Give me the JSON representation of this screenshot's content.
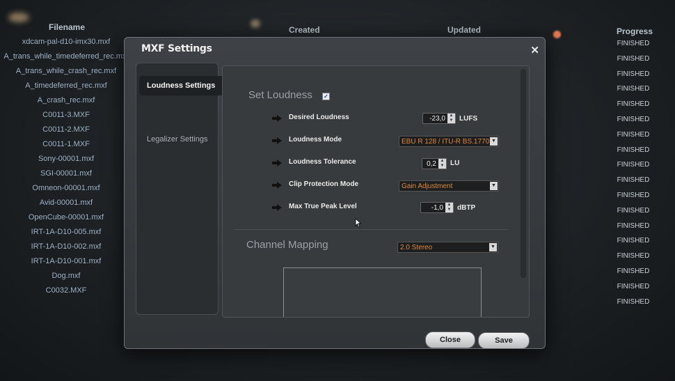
{
  "background": {
    "headers": {
      "filename": "Filename",
      "created": "Created",
      "updated": "Updated",
      "progress": "Progress"
    },
    "files": [
      "xdcam-pal-d10-imx30.mxf",
      "A_trans_while_timedeferred_rec.mxf",
      "A_trans_while_crash_rec.mxf",
      "A_timedeferred_rec.mxf",
      "A_crash_rec.mxf",
      "C0011-3.MXF",
      "C0011-2.MXF",
      "C0011-1.MXF",
      "Sony-00001.mxf",
      "SGI-00001.mxf",
      "Omneon-00001.mxf",
      "Avid-00001.mxf",
      "OpenCube-00001.mxf",
      "IRT-1A-D10-005.mxf",
      "IRT-1A-D10-002.mxf",
      "IRT-1A-D10-001.mxf",
      "Dog.mxf",
      "C0032.MXF"
    ],
    "progress": [
      "FINISHED",
      "FINISHED",
      "FINISHED",
      "FINISHED",
      "FINISHED",
      "FINISHED",
      "FINISHED",
      "FINISHED",
      "FINISHED",
      "FINISHED",
      "FINISHED",
      "FINISHED",
      "FINISHED",
      "FINISHED",
      "FINISHED",
      "FINISHED",
      "FINISHED",
      "FINISHED"
    ]
  },
  "dialog": {
    "title": "MXF Settings",
    "close_symbol": "✕",
    "tabs": [
      "Loudness Settings",
      "Legalizer Settings"
    ],
    "loudness": {
      "section_title": "Set Loudness",
      "checkbox_mark": "✓",
      "desired_loudness": {
        "label": "Desired Loudness",
        "value": "-23,0",
        "unit": "LUFS"
      },
      "loudness_mode": {
        "label": "Loudness Mode",
        "value": "EBU R 128 / ITU-R BS.1770"
      },
      "loudness_tolerance": {
        "label": "Loudness Tolerance",
        "value": "0,2",
        "unit": "LU"
      },
      "clip_protection": {
        "label": "Clip Protection Mode",
        "value": "Gain Adjustment"
      },
      "max_true_peak": {
        "label": "Max True Peak Level",
        "value": "-1,0",
        "unit": "dBTP"
      }
    },
    "channel_mapping": {
      "title": "Channel Mapping",
      "value": "2.0 Stereo"
    },
    "buttons": {
      "close": "Close",
      "save": "Save"
    }
  },
  "colors": {
    "accent_orange": "#e08a3a",
    "dialog_bg": "#383b3d"
  }
}
